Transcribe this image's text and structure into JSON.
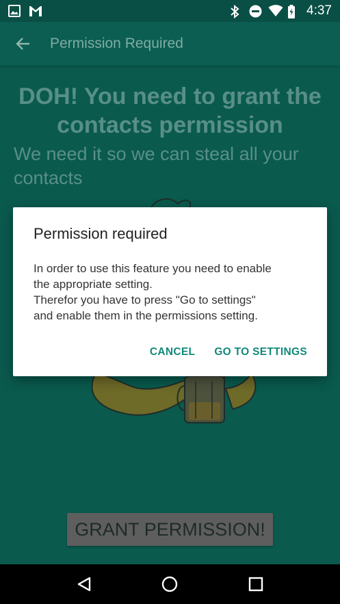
{
  "status_bar": {
    "time": "4:37",
    "icons_left": [
      "image-icon",
      "gmail-icon"
    ],
    "icons_right": [
      "bluetooth-icon",
      "do-not-disturb-icon",
      "wifi-icon",
      "battery-icon"
    ]
  },
  "app_bar": {
    "title": "Permission Required",
    "back_icon": "arrow-back-icon"
  },
  "content": {
    "headline": "DOH! You need to grant the contacts permission",
    "subline": "We need it so we can steal all your contacts",
    "grant_button": "GRANT PERMISSION!"
  },
  "dialog": {
    "title": "Permission required",
    "body_lines": [
      "In order to use this feature you need to enable",
      "the appropriate setting.",
      "Therefor you have to press \"Go to settings\"",
      "and enable them in the permissions setting."
    ],
    "cancel_label": "CANCEL",
    "settings_label": "GO TO SETTINGS"
  },
  "nav_bar": {
    "buttons": [
      "back-triangle-icon",
      "home-circle-icon",
      "recents-square-icon"
    ]
  },
  "colors": {
    "primary": "#0b5e51",
    "status_bar": "#0a4f45",
    "accent": "#12897a",
    "dialog_bg": "#ffffff"
  }
}
